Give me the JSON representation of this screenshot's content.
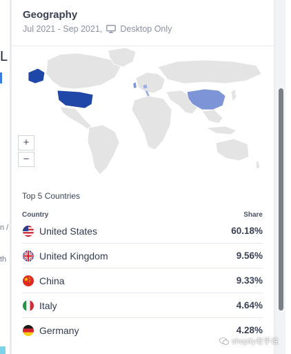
{
  "card": {
    "title": "Geography",
    "date_range": "Jul 2021 - Sep 2021,",
    "device_filter": "Desktop Only",
    "device_icon": "monitor-icon"
  },
  "map": {
    "highlight_color": "#1f47a8",
    "secondary_color": "#7d95d6",
    "land_color": "#e4e4e4",
    "zoom_in_label": "+",
    "zoom_out_label": "−"
  },
  "top_countries": {
    "section_title": "Top 5 Countries",
    "column_country": "Country",
    "column_share": "Share",
    "rows": [
      {
        "country": "United States",
        "share": "60.18%",
        "flag": "us-flag-icon"
      },
      {
        "country": "United Kingdom",
        "share": "9.56%",
        "flag": "uk-flag-icon"
      },
      {
        "country": "China",
        "share": "9.33%",
        "flag": "china-flag-icon"
      },
      {
        "country": "Italy",
        "share": "4.64%",
        "flag": "italy-flag-icon"
      },
      {
        "country": "Germany",
        "share": "4.28%",
        "flag": "germany-flag-icon"
      }
    ]
  },
  "background_fragments": {
    "left_big": "L",
    "left_small_1": "n /",
    "left_small_2": "th"
  },
  "watermark": {
    "text": "shopify老手说",
    "icon": "wechat-icon"
  }
}
